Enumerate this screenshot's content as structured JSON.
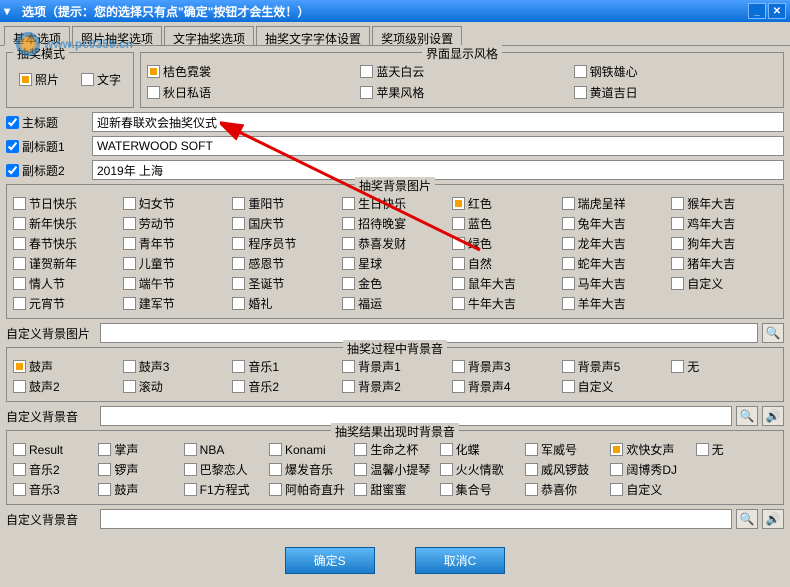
{
  "titlebar": {
    "text": "选项（提示：您的选择只有点\"确定\"按钮才会生效！）"
  },
  "tabs": [
    "基本选项",
    "照片抽奖选项",
    "文字抽奖选项",
    "抽奖文字字体设置",
    "奖项级别设置"
  ],
  "active_tab": 0,
  "mode": {
    "title": "抽奖模式",
    "opts": [
      "照片",
      "文字"
    ],
    "selected": 0
  },
  "style": {
    "title": "界面显示风格",
    "opts": [
      "桔色霓裳",
      "蓝天白云",
      "钢铁雄心",
      "秋日私语",
      "苹果风格",
      "黄道吉日"
    ],
    "selected": 0
  },
  "titles": {
    "main": {
      "label": "主标题",
      "value": "迎新春联欢会抽奖仪式"
    },
    "sub1": {
      "label": "副标题1",
      "value": "WATERWOOD SOFT"
    },
    "sub2": {
      "label": "副标题2",
      "value": "2019年 上海"
    }
  },
  "bgimg": {
    "title": "抽奖背景图片",
    "items": [
      "节日快乐",
      "妇女节",
      "重阳节",
      "生日快乐",
      "红色",
      "瑞虎呈祥",
      "猴年大吉",
      "新年快乐",
      "劳动节",
      "国庆节",
      "招待晚宴",
      "蓝色",
      "兔年大吉",
      "鸡年大吉",
      "春节快乐",
      "青年节",
      "程序员节",
      "恭喜发财",
      "绿色",
      "龙年大吉",
      "狗年大吉",
      "谨贺新年",
      "儿童节",
      "感恩节",
      "星球",
      "自然",
      "蛇年大吉",
      "猪年大吉",
      "情人节",
      "端午节",
      "圣诞节",
      "金色",
      "鼠年大吉",
      "马年大吉",
      "自定义",
      "元宵节",
      "建军节",
      "婚礼",
      "福运",
      "牛年大吉",
      "羊年大吉",
      ""
    ],
    "selected": 4
  },
  "custom_bgimg": {
    "label": "自定义背景图片",
    "value": ""
  },
  "process_sound": {
    "title": "抽奖过程中背景音",
    "items": [
      "鼓声",
      "鼓声3",
      "音乐1",
      "背景声1",
      "背景声3",
      "背景声5",
      "无",
      "鼓声2",
      "滚动",
      "音乐2",
      "背景声2",
      "背景声4",
      "自定义",
      ""
    ],
    "selected": 0
  },
  "custom_process_sound": {
    "label": "自定义背景音",
    "value": ""
  },
  "result_sound": {
    "title": "抽奖结果出现时背景音",
    "items": [
      "Result",
      "掌声",
      "NBA",
      "Konami",
      "生命之杯",
      "化蝶",
      "军威号",
      "欢快女声",
      "无",
      "音乐2",
      "锣声",
      "巴黎恋人",
      "爆发音乐",
      "温馨小提琴",
      "火火情歌",
      "威风锣鼓",
      "阔博秀DJ",
      "",
      "音乐3",
      "鼓声",
      "F1方程式",
      "阿帕奇直升",
      "甜蜜蜜",
      "集合号",
      "恭喜你",
      "自定义",
      ""
    ],
    "cols": 9,
    "selected": 7
  },
  "custom_result_sound": {
    "label": "自定义背景音",
    "value": ""
  },
  "buttons": {
    "ok": "确定S",
    "cancel": "取消C"
  },
  "watermark": "www.pc0359.cn"
}
